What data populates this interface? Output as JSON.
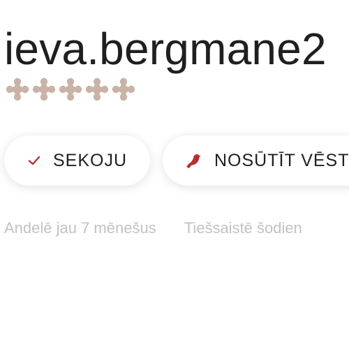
{
  "profile": {
    "username": "ieva.bergmane2",
    "rating": {
      "value": 5,
      "max": 5,
      "icon": "ornament-star-icon",
      "color": "#c9b3a6"
    }
  },
  "actions": {
    "follow_label": "SEKOJU",
    "follow_icon": "checkmark-icon",
    "message_label": "NOSŪTĪT VĒST",
    "message_icon": "pigeon-icon",
    "accent_color": "#b5302f"
  },
  "meta": {
    "member_since": "Andelē jau 7 mēnešus",
    "online_status": "Tiešsaistē šodien"
  }
}
